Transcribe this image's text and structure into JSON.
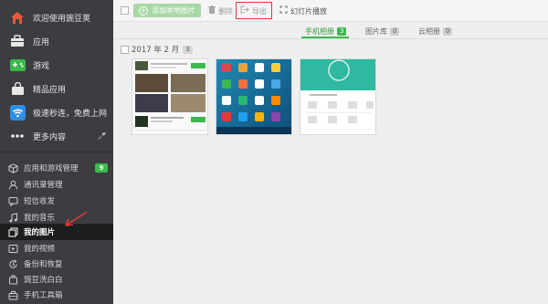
{
  "sidebar": {
    "top_items": [
      {
        "label": "欢迎使用豌豆荚",
        "icon": "home-icon"
      },
      {
        "label": "应用",
        "icon": "briefcase-icon"
      },
      {
        "label": "游戏",
        "icon": "gamepad-icon"
      },
      {
        "label": "精品应用",
        "icon": "bag-icon"
      },
      {
        "label": "极速秒连，免费上网",
        "icon": "wifi-icon"
      },
      {
        "label": "更多内容",
        "icon": "more-dots-icon"
      }
    ],
    "manage_items": [
      {
        "label": "应用和游戏管理",
        "icon": "cube-icon",
        "badge": "9"
      },
      {
        "label": "通讯录管理",
        "icon": "contact-icon"
      },
      {
        "label": "短信收发",
        "icon": "message-icon"
      },
      {
        "label": "我的音乐",
        "icon": "music-icon"
      },
      {
        "label": "我的图片",
        "icon": "picture-icon"
      },
      {
        "label": "我的视频",
        "icon": "video-icon"
      },
      {
        "label": "备份和恢复",
        "icon": "backup-icon"
      },
      {
        "label": "豌豆洗白白",
        "icon": "clean-icon"
      },
      {
        "label": "手机工具箱",
        "icon": "toolbox-icon"
      }
    ],
    "active_item": "我的图片"
  },
  "toolbar": {
    "add_label": "添加本地图片",
    "delete_label": "删除",
    "export_label": "导出",
    "slideshow_label": "幻灯片播放"
  },
  "tabs": [
    {
      "label": "手机相册",
      "count": "3"
    },
    {
      "label": "图片库",
      "count": "0"
    },
    {
      "label": "云相册",
      "count": "0"
    }
  ],
  "group": {
    "title": "2017 年 2 月",
    "count": "3"
  },
  "thumbnails": [
    {
      "name": "screenshot-app-list"
    },
    {
      "name": "screenshot-home-screen"
    },
    {
      "name": "screenshot-cleaner-app"
    }
  ],
  "colors": {
    "sidebar": "#3b3d40",
    "accent": "#3cb94e",
    "highlight": "#e53935"
  }
}
